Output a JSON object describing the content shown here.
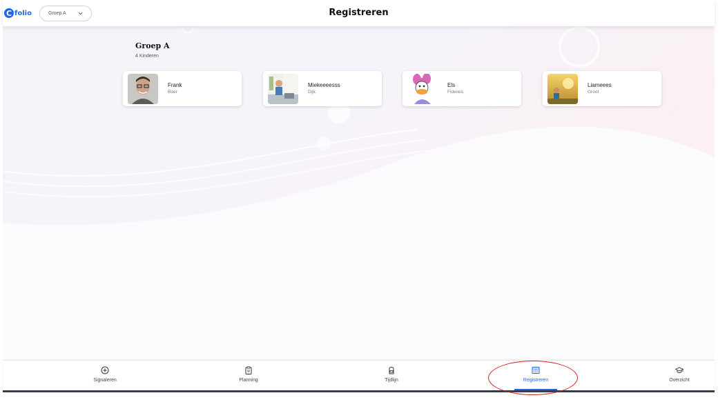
{
  "header": {
    "logo_mark": "C",
    "logo_text": "folio",
    "group_select": "Groep A",
    "title": "Registreren"
  },
  "group": {
    "title": "Groep A",
    "count": "4 Kinderen"
  },
  "children": [
    {
      "first": "Frank",
      "last": "Boer",
      "avatar": "portrait-photo"
    },
    {
      "first": "Miekeeeesss",
      "last": "Dijk",
      "avatar": "kid-photo"
    },
    {
      "first": "Els",
      "last": "Fidereis",
      "avatar": "cartoon-duck"
    },
    {
      "first": "Liameees",
      "last": "Groot",
      "avatar": "sunset-photo"
    }
  ],
  "nav": [
    {
      "label": "Signaleren",
      "icon": "plus-circle-icon"
    },
    {
      "label": "Planning",
      "icon": "clipboard-icon"
    },
    {
      "label": "Tijdlijn",
      "icon": "backpack-icon"
    },
    {
      "label": "Registreren",
      "icon": "register-icon",
      "active": true
    },
    {
      "label": "Overzicht",
      "icon": "graduation-cap-icon"
    }
  ],
  "colors": {
    "brand": "#1e66e8",
    "annotation": "#d42020"
  }
}
